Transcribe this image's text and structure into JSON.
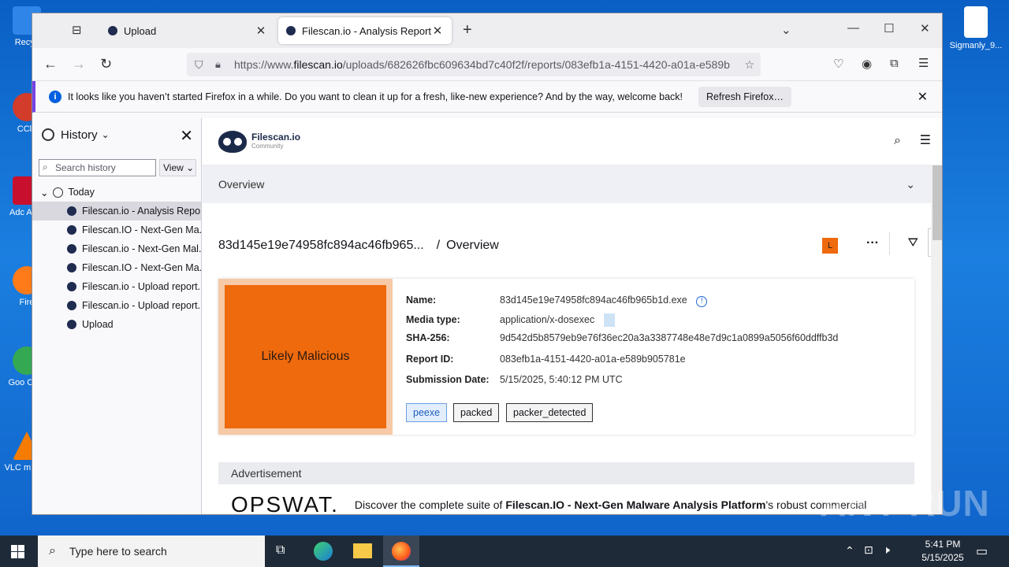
{
  "desktop": {
    "icons": [
      {
        "label": "Recyc",
        "color": "#2f86e8"
      },
      {
        "label": "CCle",
        "color": "#d33b2a"
      },
      {
        "label": "Adc Acro",
        "color": "#c8102e"
      },
      {
        "label": "Fire",
        "color": "#ff7a18"
      },
      {
        "label": "Goo Chrc",
        "color": "#34a853"
      },
      {
        "label": "VLC m play",
        "color": "#f57c00"
      },
      {
        "label": "Sigmanly_9...",
        "color": "#ffffff"
      }
    ]
  },
  "browser": {
    "tabs": [
      {
        "label": "Upload",
        "active": false
      },
      {
        "label": "Filescan.io - Analysis Report for",
        "active": true
      }
    ],
    "url_prefix": "https://www.",
    "url_domain": "filescan.io",
    "url_rest": "/uploads/682626fbc609634bd7c40f2f/reports/083efb1a-4151-4420-a01a-e589b",
    "notification": {
      "message": "It looks like you haven’t started Firefox in a while. Do you want to clean it up for a fresh, like-new experience? And by the way, welcome back!",
      "button": "Refresh Firefox…"
    }
  },
  "sidebar": {
    "title": "History",
    "search_placeholder": "Search history",
    "view_label": "View",
    "group": "Today",
    "items": [
      {
        "label": "Filescan.io - Analysis Repo...",
        "selected": true
      },
      {
        "label": "Filescan.IO - Next-Gen Ma...",
        "selected": false
      },
      {
        "label": "Filescan.io - Next-Gen Mal...",
        "selected": false
      },
      {
        "label": "Filescan.IO - Next-Gen Ma...",
        "selected": false
      },
      {
        "label": "Filescan.io - Upload report...",
        "selected": false
      },
      {
        "label": "Filescan.io - Upload report...",
        "selected": false
      },
      {
        "label": "Upload",
        "selected": false
      }
    ]
  },
  "page": {
    "brand": "Filescan.io",
    "brand_sub": "Community",
    "overview_label": "Overview",
    "file_short": "83d145e19e74958fc894ac46fb965...",
    "separator": "/",
    "crumb": "Overview",
    "level_badge": "L",
    "verdict": "Likely Malicious",
    "fields": {
      "name_k": "Name:",
      "name_v": "83d145e19e74958fc894ac46fb965b1d.exe",
      "media_k": "Media type:",
      "media_v": "application/x-dosexec",
      "sha_k": "SHA-256:",
      "sha_v": "9d542d5b8579eb9e76f36ec20a3a3387748e48e7d9c1a0899a5056f60ddffb3d",
      "report_k": "Report ID:",
      "report_v": "083efb1a-4151-4420-a01a-e589b905781e",
      "date_k": "Submission Date:",
      "date_v": "5/15/2025, 5:40:12 PM UTC"
    },
    "tags": [
      "peexe",
      "packed",
      "packer_detected"
    ],
    "ad": {
      "header": "Advertisement",
      "logo": "OPSWAT.",
      "text_pre": "Discover the complete suite of ",
      "text_bold": "Filescan.IO - Next-Gen Malware Analysis Platform",
      "text_post": "'s robust commercial"
    }
  },
  "taskbar": {
    "search_placeholder": "Type here to search",
    "time": "5:41 PM",
    "date": "5/15/2025"
  },
  "watermark": "ANY RUN"
}
